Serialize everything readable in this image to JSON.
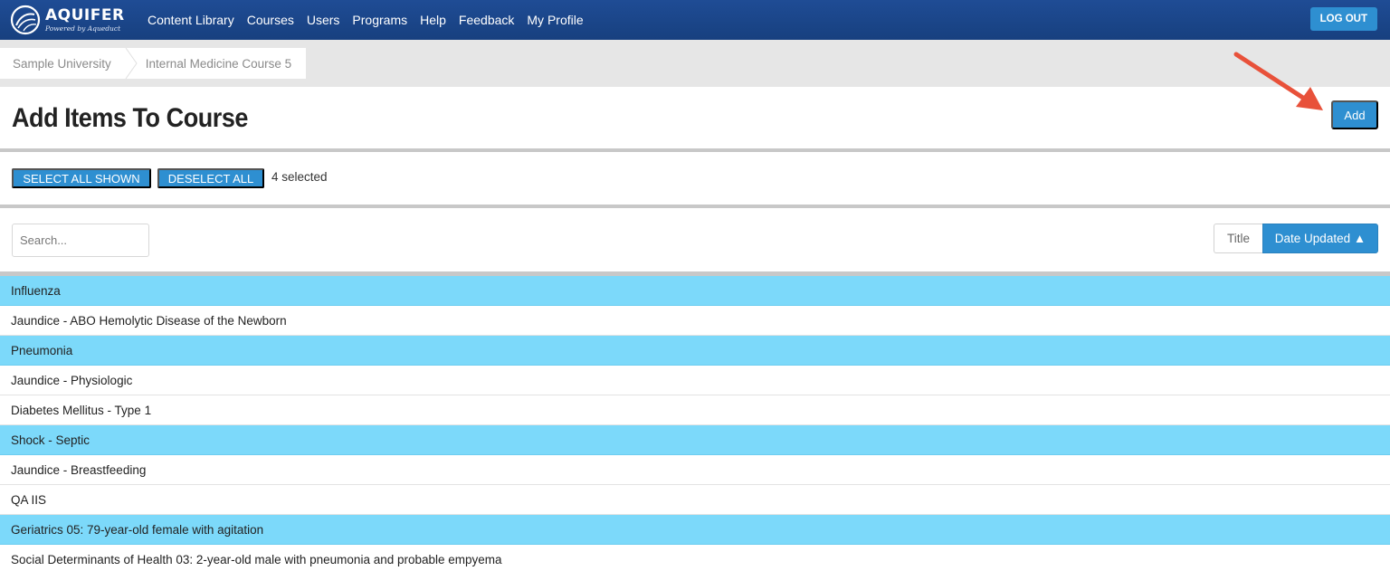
{
  "app": {
    "logo_name": "AQUIFER",
    "logo_tagline": "Powered by Aqueduct"
  },
  "nav": {
    "links": [
      "Content Library",
      "Courses",
      "Users",
      "Programs",
      "Help",
      "Feedback",
      "My Profile"
    ],
    "logout_label": "LOG OUT"
  },
  "breadcrumb": [
    "Sample University",
    "Internal Medicine Course 5"
  ],
  "page": {
    "title": "Add Items To Course",
    "add_label": "Add"
  },
  "selection": {
    "select_all_label": "SELECT ALL SHOWN",
    "deselect_all_label": "DESELECT ALL",
    "selected_text": "4 selected"
  },
  "search": {
    "placeholder": "Search...",
    "value": ""
  },
  "sort": {
    "options": [
      "Title",
      "Date Updated ▲"
    ],
    "active": "Date Updated ▲"
  },
  "items": [
    {
      "label": "Influenza",
      "selected": true
    },
    {
      "label": "Jaundice - ABO Hemolytic Disease of the Newborn",
      "selected": false
    },
    {
      "label": "Pneumonia",
      "selected": true
    },
    {
      "label": "Jaundice - Physiologic",
      "selected": false
    },
    {
      "label": "Diabetes Mellitus - Type 1",
      "selected": false
    },
    {
      "label": "Shock - Septic",
      "selected": true
    },
    {
      "label": "Jaundice - Breastfeeding",
      "selected": false
    },
    {
      "label": "QA IIS",
      "selected": false
    },
    {
      "label": "Geriatrics 05: 79-year-old female with agitation",
      "selected": true
    },
    {
      "label": "Social Determinants of Health 03: 2-year-old male with pneumonia and probable empyema",
      "selected": false
    }
  ],
  "colors": {
    "nav_bg": "#1f4c95",
    "button_blue": "#2e8fd1",
    "selected_row": "#7cd9fa",
    "annotation_arrow": "#e8513a"
  },
  "icons": {
    "logo": "aquifer-logo-icon",
    "annotation": "arrow-annotation-icon"
  }
}
